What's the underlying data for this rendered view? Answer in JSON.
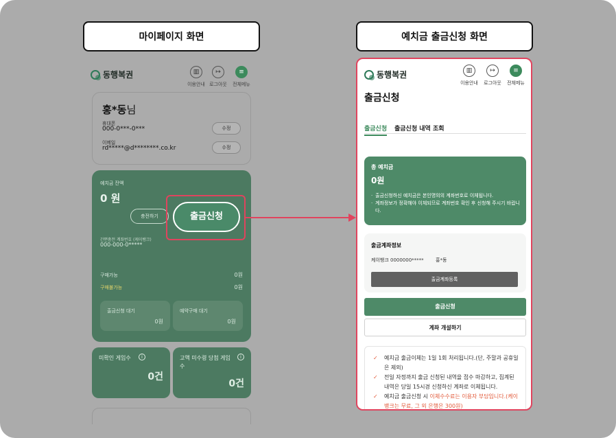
{
  "labels": {
    "left_title": "마이페이지 화면",
    "right_title": "예치금 출금신청 화면"
  },
  "brand": "동행복권",
  "header_icons": [
    "이용안내",
    "로그아웃",
    "전체메뉴"
  ],
  "profile": {
    "name": "홍*동",
    "suffix": "님",
    "phone_label": "휴대폰",
    "phone": "000-0***-0***",
    "email_label": "이메일",
    "email": "rd*****@d********.co.kr",
    "edit": "수정"
  },
  "balance": {
    "label": "예치금 잔액",
    "amount": "0 원",
    "charge_button": "충전하기",
    "withdraw_button": "출금신청",
    "account_label": "간편충전 계좌번호 (케이뱅크)",
    "account": "000-000-0*****",
    "buyable_label": "구매가능",
    "buyable_value": "0원",
    "unbuyable_label": "구매불가능",
    "unbuyable_value": "0원",
    "pending_label": "출금신청 대기",
    "pending_value": "0원",
    "reserve_label": "예약구매 대기",
    "reserve_value": "0원"
  },
  "mini_cards": [
    {
      "title": "미확인 게임수",
      "value": "0건"
    },
    {
      "title": "고액 미수령 당첨 게임수",
      "value": "0건"
    }
  ],
  "right": {
    "page_title": "출금신청",
    "tabs": [
      "출금신청",
      "출금신청 내역 조회"
    ],
    "deposit_label": "총 예치금",
    "deposit_amount": "0원",
    "deposit_notes": [
      "출금신청하신 예치금은 본인명의의 계좌번호로 이체됩니다.",
      "계좌정보가 정확해야 이체되므로 계좌번호 확인 후 신청해 주시기 바랍니다."
    ],
    "account_section_title": "출금계좌정보",
    "account_line": "케이뱅크 0000000*****",
    "account_holder": "홍*동",
    "register_button": "출금계좌등록",
    "apply_button": "출금신청",
    "open_account_button": "계좌 개설하기",
    "notices": [
      {
        "text": "예치금 출금이체는 1일 1회 처리됩니다.(단, 주말과 공휴일은 제외)"
      },
      {
        "text": "전일 자정까지 출금 신청된 내역을 접수 마감하고, 집계된 내역은 당일 15시경 신청하신 계좌로 이체됩니다."
      },
      {
        "text_pre": "예치금 출금신청 시 ",
        "text_hl": "이체수수료는 이용자 부담입니다.(케이뱅크는 무료, 그 외 은행은 300원)"
      }
    ]
  },
  "colors": {
    "brand_green": "#4e8a68",
    "highlight": "#e0445e",
    "warning": "#e25a3a"
  }
}
